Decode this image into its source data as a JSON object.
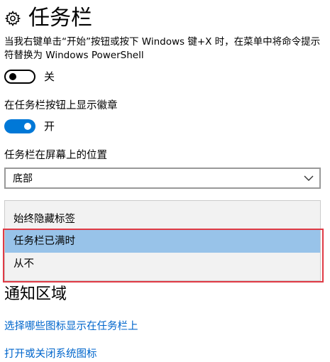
{
  "header": {
    "icon": "gear-icon",
    "title": "任务栏"
  },
  "powershell_setting": {
    "description": "当我右键单击“开始”按钮或按下 Windows 键+X 时，在菜单中将命令提示符替换为 Windows PowerShell",
    "state": "off",
    "state_label": "关"
  },
  "badges_setting": {
    "label": "在任务栏按钮上显示徽章",
    "state": "on",
    "state_label": "开"
  },
  "position_setting": {
    "label": "任务栏在屏幕上的位置",
    "selected": "底部"
  },
  "combine_dropdown": {
    "options": [
      "始终隐藏标签",
      "任务栏已满时",
      "从不"
    ],
    "highlighted_index": 1
  },
  "notification_area": {
    "heading": "通知区域",
    "links": [
      "选择哪些图标显示在任务栏上",
      "打开或关闭系统图标"
    ]
  },
  "colors": {
    "accent": "#0078d7",
    "link": "#0066cc",
    "highlight": "#98c3e9",
    "annotation_box": "#e03a45"
  }
}
